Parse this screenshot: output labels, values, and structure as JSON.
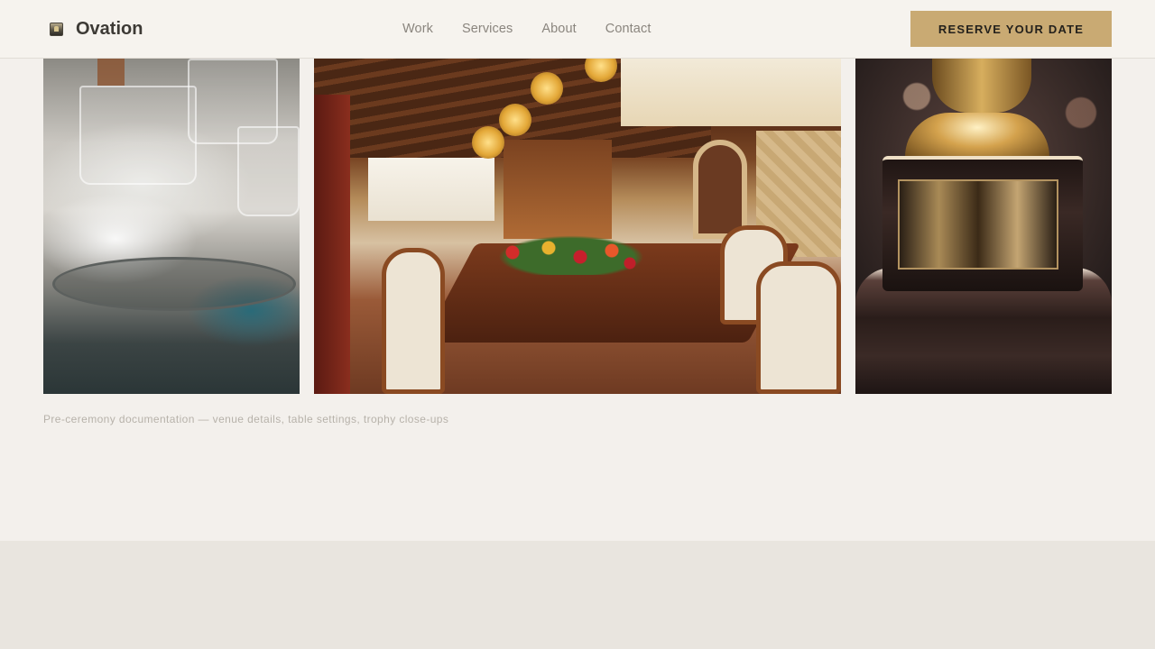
{
  "header": {
    "brand_name": "Ovation",
    "logo_icon": "building-icon",
    "nav": [
      "Work",
      "Services",
      "About",
      "Contact"
    ],
    "cta_label": "RESERVE YOUR DATE"
  },
  "gallery": {
    "images": [
      {
        "name": "glassware-table-setting"
      },
      {
        "name": "dining-hall-venue"
      },
      {
        "name": "trophy-close-up"
      }
    ],
    "caption": "Pre-ceremony documentation — venue details, table settings, trophy close-ups"
  },
  "colors": {
    "background": "#f3f0ec",
    "accent": "#c9aa73",
    "footer_band": "#e9e5df",
    "nav_text": "#8a857e",
    "brand_text": "#3d3a35"
  }
}
